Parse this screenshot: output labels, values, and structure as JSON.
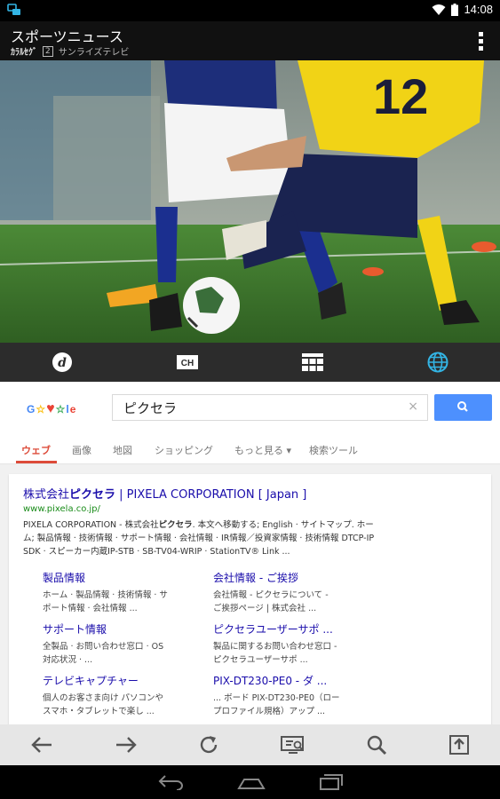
{
  "status": {
    "time": "14:08"
  },
  "appbar": {
    "title": "スポーツニュース",
    "logo_text": "ｶﾗﾙｾｸﾞ",
    "channel_num": "2",
    "channel_name": "サンライズテレビ"
  },
  "video": {
    "jersey_number": "12"
  },
  "bottom_tabs": [
    {
      "name": "d-icon"
    },
    {
      "name": "ch-icon"
    },
    {
      "name": "grid-icon"
    },
    {
      "name": "globe-icon",
      "active": true
    }
  ],
  "search": {
    "logo": "G☆♥☆le",
    "query": "ピクセラ",
    "clear": "×"
  },
  "nav": {
    "web": "ウェブ",
    "images": "画像",
    "maps": "地図",
    "shopping": "ショッピング",
    "more": "もっと見る ▾",
    "tools": "検索ツール"
  },
  "result": {
    "title_a": "株式会社",
    "title_b": "ピクセラ",
    "title_c": " | PIXELA CORPORATION [ Japan ]",
    "url": "www.pixela.co.jp/",
    "snippet_1a": "PIXELA CORPORATION - 株式会社",
    "snippet_1b": "ピクセラ",
    "snippet_1c": ". 本文へ移動する; English · サイトマップ. ホー",
    "snippet_2": "ム; 製品情報 · 技術情報 · サポート情報 · 会社情報 · IR情報／投資家情報 · 技術情報 DTCP-IP",
    "snippet_3": "SDK · スピーカー内蔵IP-STB · SB-TV04-WRIP · StationTV® Link ..."
  },
  "sitelinks": [
    {
      "title": "製品情報",
      "desc1": "ホーム · 製品情報 · 技術情報 · サ",
      "desc2": "ポート情報 · 会社情報 ..."
    },
    {
      "title": "会社情報 - ご挨拶",
      "desc1": "会社情報 - ピクセラについて -",
      "desc2": "ご挨拶ページ | 株式会社 ..."
    },
    {
      "title": "サポート情報",
      "desc1": "全製品 · お問い合わせ窓口 · OS",
      "desc2": "対応状況 · ..."
    },
    {
      "title": "ピクセラユーザーサポ ...",
      "desc1": "製品に関するお問い合わせ窓口 -",
      "desc2": "ピクセラユーザーサポ ..."
    },
    {
      "title": "テレビキャプチャー",
      "desc1": "個人のお客さま向け パソコンや",
      "desc2": "スマホ・タブレットで楽し ..."
    },
    {
      "title": "PIX-DT230-PE0 - ダ ...",
      "desc1": "... ボード PIX-DT230-PE0（ロー",
      "desc2": "プロファイル規格）アップ ..."
    }
  ]
}
